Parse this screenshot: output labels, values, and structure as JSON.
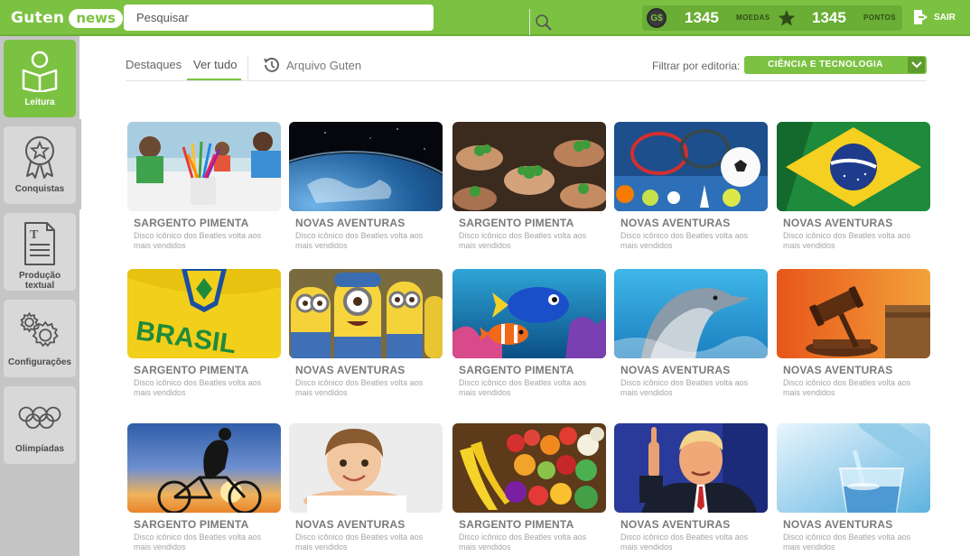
{
  "header": {
    "logo": {
      "part1": "Guten",
      "part2": "news"
    },
    "search_placeholder": "Pesquisar",
    "coins_value": "1345",
    "coins_label": "MOEDAS",
    "coin_symbol": "G$",
    "points_value": "1345",
    "points_label": "PONTOS",
    "logout_label": "SAIR"
  },
  "sidebar": {
    "items": [
      {
        "label": "Leitura",
        "icon": "reading-icon",
        "active": true
      },
      {
        "label": "Conquistas",
        "icon": "award-icon",
        "active": false
      },
      {
        "label": "Produção textual",
        "icon": "document-icon",
        "active": false
      },
      {
        "label": "Configurações",
        "icon": "gear-icon",
        "active": false
      },
      {
        "label": "Olimpíadas",
        "icon": "olympic-rings-icon",
        "active": false
      }
    ]
  },
  "tabs": [
    {
      "label": "Destaques",
      "active": false
    },
    {
      "label": "Ver tudo",
      "active": true
    },
    {
      "label": "Arquivo Guten",
      "icon": "history-icon",
      "active": false
    }
  ],
  "filter": {
    "label": "Filtrar por editoria:",
    "value": "CIÊNCIA E TECNOLOGIA"
  },
  "cards": [
    {
      "title": "SARGENTO PIMENTA",
      "desc": "Disco icônico dos Beatles volta aos mais vendidos",
      "image": "children-drawing"
    },
    {
      "title": "NOVAS AVENTURAS",
      "desc": "Disco icônico dos Beatles volta aos mais vendidos",
      "image": "earth-from-space"
    },
    {
      "title": "SARGENTO PIMENTA",
      "desc": "Disco icônico dos Beatles volta aos mais vendidos",
      "image": "hands-holding-plants"
    },
    {
      "title": "NOVAS AVENTURAS",
      "desc": "Disco icônico dos Beatles volta aos mais vendidos",
      "image": "sports-balls"
    },
    {
      "title": "NOVAS AVENTURAS",
      "desc": "Disco icônico dos Beatles volta aos mais vendidos",
      "image": "brazil-flag"
    },
    {
      "title": "SARGENTO PIMENTA",
      "desc": "Disco icônico dos Beatles volta aos mais vendidos",
      "image": "brasil-jersey"
    },
    {
      "title": "NOVAS AVENTURAS",
      "desc": "Disco icônico dos Beatles volta aos mais vendidos",
      "image": "minions"
    },
    {
      "title": "SARGENTO PIMENTA",
      "desc": "Disco icônico dos Beatles volta aos mais vendidos",
      "image": "clownfish-reef"
    },
    {
      "title": "NOVAS AVENTURAS",
      "desc": "Disco icônico dos Beatles volta aos mais vendidos",
      "image": "dolphin"
    },
    {
      "title": "NOVAS AVENTURAS",
      "desc": "Disco icônico dos Beatles volta aos mais vendidos",
      "image": "judge-gavel"
    },
    {
      "title": "SARGENTO PIMENTA",
      "desc": "Disco icônico dos Beatles volta aos mais vendidos",
      "image": "cyclist-sunset"
    },
    {
      "title": "NOVAS AVENTURAS",
      "desc": "Disco icônico dos Beatles volta aos mais vendidos",
      "image": "smiling-boy"
    },
    {
      "title": "SARGENTO PIMENTA",
      "desc": "Disco icônico dos Beatles volta aos mais vendidos",
      "image": "fruits-vegetables"
    },
    {
      "title": "NOVAS AVENTURAS",
      "desc": "Disco icônico dos Beatles volta aos mais vendidos",
      "image": "man-pointing"
    },
    {
      "title": "NOVAS AVENTURAS",
      "desc": "Disco icônico dos Beatles volta aos mais vendidos",
      "image": "water-glass"
    }
  ],
  "colors": {
    "brand": "#7cc242",
    "brand_dark": "#6aae35",
    "sidebar": "#c5c5c5"
  }
}
